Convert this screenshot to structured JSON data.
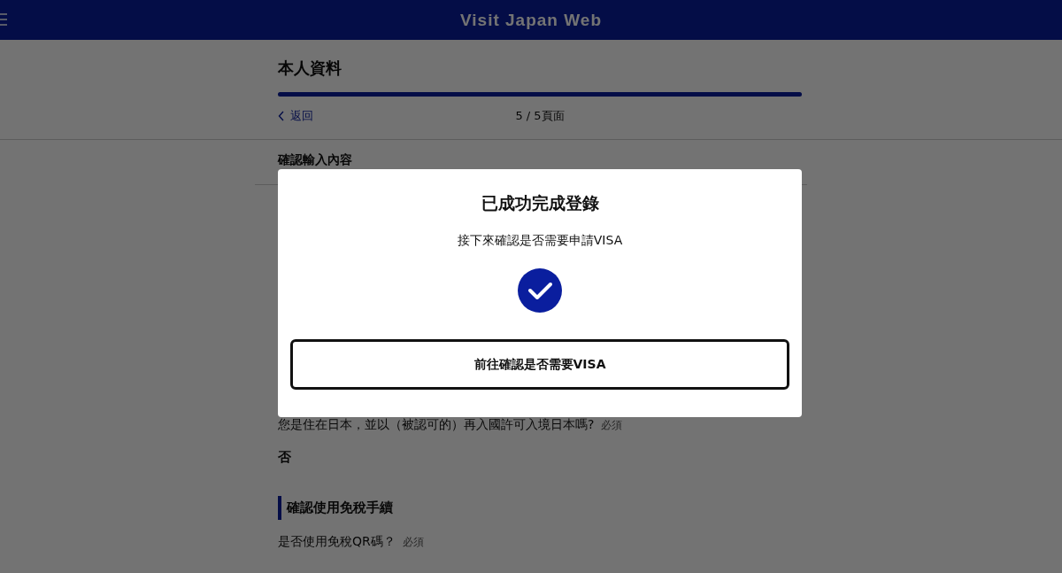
{
  "header": {
    "title": "Visit Japan Web"
  },
  "page": {
    "title": "本人資料",
    "progress": {
      "level": 1
    },
    "back": "返回",
    "page_count": "5 / 5頁面"
  },
  "section": {
    "title": "確認輸入內容"
  },
  "questions": [
    {
      "question": "您是住在日本，並以（被認可的）再入國許可入境日本嗎?",
      "required": "必須",
      "answer": "否"
    }
  ],
  "subsection": {
    "title": "確認使用免稅手續",
    "questions": [
      {
        "question": "是否使用免稅QR碼？",
        "required": "必須"
      }
    ]
  },
  "dialog": {
    "title": "已成功完成登錄",
    "message": "接下來確認是否需要申請VISA",
    "button": "前往確認是否需要VISA"
  }
}
